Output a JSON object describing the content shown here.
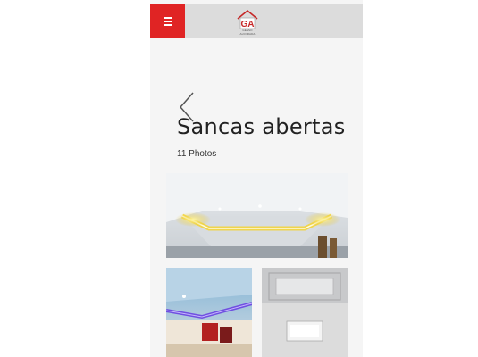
{
  "header": {
    "menu_icon": "hamburger-icon",
    "logo_letters": "GA",
    "logo_tagline": "GESSO ALVORADA",
    "colors": {
      "menu_bg": "#e02424",
      "header_bg": "#dcdcdc"
    }
  },
  "gallery": {
    "back_icon": "chevron-left-icon",
    "title": "Sancas abertas",
    "count_label": "11 Photos"
  }
}
